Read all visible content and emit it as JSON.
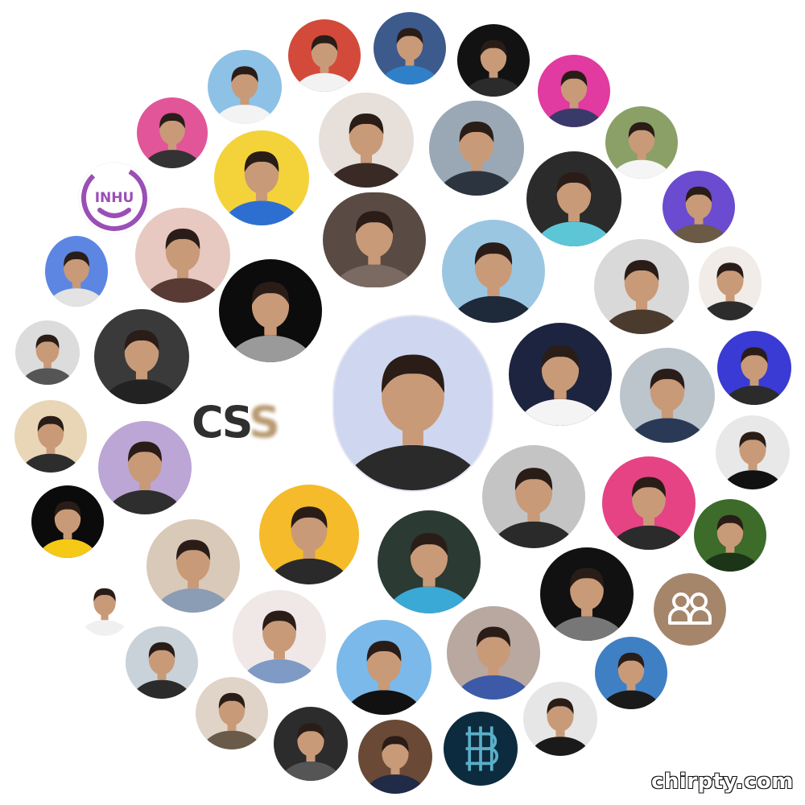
{
  "watermark": "chirpty.com",
  "logos": {
    "inhu_text": "INHU",
    "css_text_a": "CS",
    "css_text_b": "S"
  },
  "colors": {
    "background": "#ffffff",
    "inhu_purple": "#9a4fb6",
    "css_tan": "#b99a72",
    "people_icon_bg": "#a6866b",
    "dotpattern_blue": "#3a6fd8",
    "avatar_skin": "#c99a78",
    "avatar_hair": "#2a1d18"
  },
  "avatars": [
    {
      "name": "avatar-center-mask",
      "bg": "#cfd6ef",
      "shirt": "#2a2a2a",
      "icon": "person"
    },
    {
      "name": "avatar-red-room",
      "bg": "#d34a3a",
      "shirt": "#f2f2f2",
      "icon": "person"
    },
    {
      "name": "avatar-blue-bg-man",
      "bg": "#3d5a8c",
      "shirt": "#2f80c8",
      "icon": "person"
    },
    {
      "name": "avatar-dark-bg-man",
      "bg": "#121212",
      "shirt": "#2b2b2b",
      "icon": "person"
    },
    {
      "name": "avatar-rainbow-bg-man",
      "bg": "#e13aa0",
      "shirt": "#3a3a6a",
      "icon": "person"
    },
    {
      "name": "avatar-sky-bg-man",
      "bg": "#8ec1e6",
      "shirt": "#f3f3f3",
      "icon": "person"
    },
    {
      "name": "avatar-pink-ring-man",
      "bg": "#e25598",
      "shirt": "#333333",
      "icon": "person"
    },
    {
      "name": "avatar-yellow-bg-man",
      "bg": "#f4d33a",
      "shirt": "#2d6fd0",
      "icon": "person"
    },
    {
      "name": "avatar-woman-long-hair",
      "bg": "#e6dfda",
      "shirt": "#3a2a26",
      "icon": "person"
    },
    {
      "name": "avatar-grey-bg-man",
      "bg": "#9aa8b6",
      "shirt": "#2c3440",
      "icon": "person"
    },
    {
      "name": "avatar-cartoon-cat",
      "bg": "#2b2b2b",
      "shirt": "#5cc6d6",
      "icon": "person"
    },
    {
      "name": "avatar-glasses-woman",
      "bg": "#8aa067",
      "shirt": "#f5f5f5",
      "icon": "person"
    },
    {
      "name": "avatar-purple-ring-man",
      "bg": "#6b4bd0",
      "shirt": "#6a5a46",
      "icon": "person"
    },
    {
      "name": "avatar-monkey-sketch",
      "bg": "#594a43",
      "shirt": "#7a6a62",
      "icon": "person"
    },
    {
      "name": "avatar-bokeh-woman",
      "bg": "#e7c9c1",
      "shirt": "#5a3a34",
      "icon": "person"
    },
    {
      "name": "avatar-blue-pattern-man",
      "bg": "#5d86e3",
      "shirt": "#e3e3e3",
      "icon": "person"
    },
    {
      "name": "avatar-black-small-figure",
      "bg": "#0c0c0c",
      "shirt": "#9a9a9a",
      "icon": "person"
    },
    {
      "name": "avatar-smiling-man-blue-bg",
      "bg": "#9ac6e2",
      "shirt": "#1e2a3a",
      "icon": "person"
    },
    {
      "name": "avatar-masked-man",
      "bg": "#d9d9d9",
      "shirt": "#4a3b2e",
      "icon": "person"
    },
    {
      "name": "avatar-man-white-bg",
      "bg": "#f1ece8",
      "shirt": "#2c2c2c",
      "icon": "person"
    },
    {
      "name": "avatar-bw-glasses-man",
      "bg": "#dcdcdc",
      "shirt": "#555555",
      "icon": "person"
    },
    {
      "name": "avatar-bw-woman",
      "bg": "#3a3a3a",
      "shirt": "#222222",
      "icon": "person"
    },
    {
      "name": "avatar-suit-navy-bg",
      "bg": "#1d2440",
      "shirt": "#f4f4f4",
      "icon": "person"
    },
    {
      "name": "avatar-colosseum-man",
      "bg": "#bcc4cc",
      "shirt": "#2a3a56",
      "icon": "person"
    },
    {
      "name": "avatar-purple-bg-boy",
      "bg": "#3a3bd4",
      "shirt": "#2b2b2b",
      "icon": "person"
    },
    {
      "name": "avatar-woman-selfie",
      "bg": "#e9d6b6",
      "shirt": "#2d2d2d",
      "icon": "person"
    },
    {
      "name": "avatar-purple-glow-man",
      "bg": "#bba6d6",
      "shirt": "#2e2e2e",
      "icon": "person"
    },
    {
      "name": "avatar-bw-sunglasses-woman",
      "bg": "#c4c4c4",
      "shirt": "#2a2a2a",
      "icon": "person"
    },
    {
      "name": "avatar-bw-woman-right",
      "bg": "#e8e8e8",
      "shirt": "#111111",
      "icon": "person"
    },
    {
      "name": "avatar-pink-bg-man",
      "bg": "#e54384",
      "shirt": "#2b2b2b",
      "icon": "person"
    },
    {
      "name": "avatar-hijab-woman",
      "bg": "#f5bb2a",
      "shirt": "#2a2a2a",
      "icon": "person"
    },
    {
      "name": "avatar-solar-dot",
      "bg": "#0b0b0b",
      "shirt": "#f5c916",
      "icon": "person"
    },
    {
      "name": "avatar-curly-hair-man",
      "bg": "#d9c9b8",
      "shirt": "#8b9db4",
      "icon": "person"
    },
    {
      "name": "avatar-city-night-man",
      "bg": "#2b3a32",
      "shirt": "#3aa9d6",
      "icon": "person"
    },
    {
      "name": "avatar-green-anime",
      "bg": "#3c6b2a",
      "shirt": "#1c3518",
      "icon": "person"
    },
    {
      "name": "avatar-dark-mirror-woman",
      "bg": "#111111",
      "shirt": "#777777",
      "icon": "person"
    },
    {
      "name": "avatar-white-shirt-man",
      "bg": "#ffffff",
      "shirt": "#f0f0f0",
      "icon": "person"
    },
    {
      "name": "avatar-glasses-young-man",
      "bg": "#f0e8e6",
      "shirt": "#7f9ac4",
      "icon": "person"
    },
    {
      "name": "avatar-smiling-outdoors-man",
      "bg": "#c8d2d8",
      "shirt": "#2b2b2b",
      "icon": "person"
    },
    {
      "name": "avatar-happy-glasses-man",
      "bg": "#7ab9ea",
      "shirt": "#111111",
      "icon": "person"
    },
    {
      "name": "avatar-door-man",
      "bg": "#b8a8a0",
      "shirt": "#3d5aa8",
      "icon": "person"
    },
    {
      "name": "avatar-bald-glasses-man",
      "bg": "#3f7fc4",
      "shirt": "#1a1a1a",
      "icon": "person"
    },
    {
      "name": "avatar-car-selfie",
      "bg": "#e0d4c8",
      "shirt": "#6a5a4a",
      "icon": "person"
    },
    {
      "name": "avatar-glasses-dark-man",
      "bg": "#2c2c2c",
      "shirt": "#555555",
      "icon": "person"
    },
    {
      "name": "avatar-suit-man",
      "bg": "#6a4a36",
      "shirt": "#1f2b47",
      "icon": "person"
    },
    {
      "name": "avatar-b-logo",
      "bg": "#0d2b3e",
      "shirt": "#5ab0c8",
      "icon": "b-logo"
    },
    {
      "name": "avatar-cap-bearded-man",
      "bg": "#e6e6e6",
      "shirt": "#1a1a1a",
      "icon": "person"
    }
  ]
}
